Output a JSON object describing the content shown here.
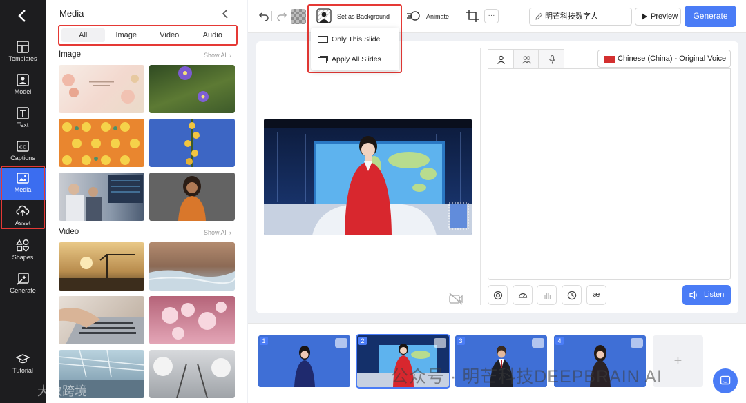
{
  "colors": {
    "accent": "#4a7cf6",
    "highlight_outline": "#e53935",
    "nav_bg": "#1d1d1f"
  },
  "nav": {
    "back_icon": "chevron-left-icon",
    "items": [
      {
        "label": "Templates",
        "icon": "templates-icon"
      },
      {
        "label": "Model",
        "icon": "model-icon"
      },
      {
        "label": "Text",
        "icon": "text-icon"
      },
      {
        "label": "Captions",
        "icon": "captions-icon"
      },
      {
        "label": "Media",
        "icon": "media-icon",
        "active": true
      },
      {
        "label": "Asset",
        "icon": "upload-icon"
      },
      {
        "label": "Shapes",
        "icon": "shapes-icon"
      },
      {
        "label": "Generate",
        "icon": "generate-icon"
      },
      {
        "label": "Tutorial",
        "icon": "tutorial-icon"
      }
    ]
  },
  "media_panel": {
    "title": "Media",
    "tabs": [
      "All",
      "Image",
      "Video",
      "Audio"
    ],
    "active_tab": "All",
    "image_section": {
      "label": "Image",
      "show_all": "Show All ›"
    },
    "video_section": {
      "label": "Video",
      "show_all": "Show All ›"
    }
  },
  "toolbar": {
    "set_background": "Set as Background",
    "animate": "Animate",
    "more": "···",
    "project_name": "明芒科技数字人",
    "preview": "Preview",
    "generate": "Generate"
  },
  "background_menu": {
    "items": [
      "Only This Slide",
      "Apply All Slides"
    ]
  },
  "script_panel": {
    "voice": "Chinese (China) - Original Voice",
    "listen": "Listen",
    "tools": [
      "openai-icon",
      "speed-icon",
      "gesture-icon",
      "timer-icon",
      "æ"
    ]
  },
  "slides": [
    {
      "number": "1"
    },
    {
      "number": "2",
      "active": true
    },
    {
      "number": "3"
    },
    {
      "number": "4"
    }
  ],
  "add_slide": "+",
  "watermarks": {
    "primary": "公众号 · 明芒科技DEEPBRAIN AI",
    "secondary": "大数跨境"
  }
}
